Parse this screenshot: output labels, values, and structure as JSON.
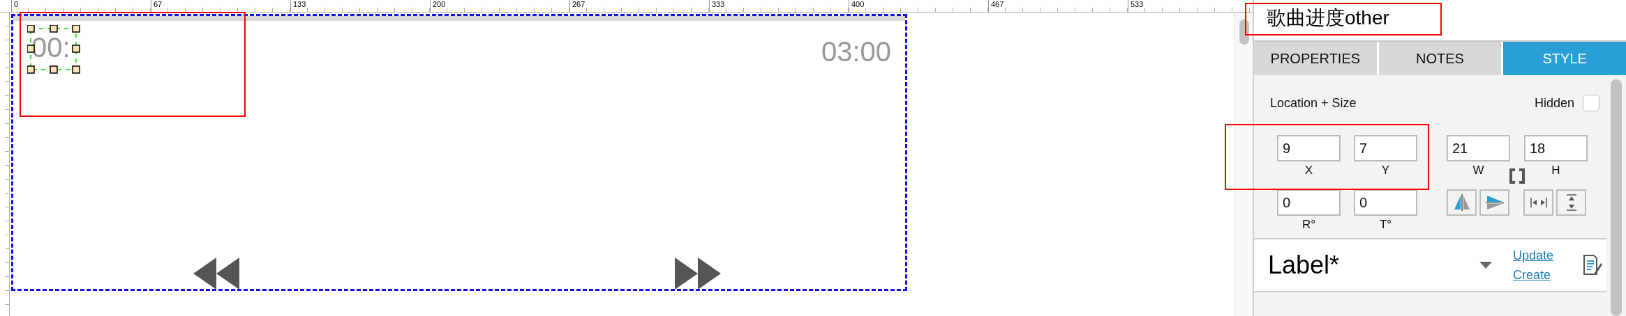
{
  "ruler": {
    "labels": [
      "0",
      "67",
      "133",
      "200",
      "267",
      "333",
      "400",
      "467",
      "533"
    ]
  },
  "canvas": {
    "start_time": "00:",
    "end_time": "03:00",
    "controls": [
      {
        "kind": "rewind"
      },
      {
        "kind": "fast_forward"
      }
    ]
  },
  "panel": {
    "title": "歌曲进度other",
    "tabs": [
      {
        "label": "PROPERTIES",
        "selected": false
      },
      {
        "label": "NOTES",
        "selected": false
      },
      {
        "label": "STYLE",
        "selected": true
      }
    ],
    "section": "Location + Size",
    "hidden": {
      "label": "Hidden",
      "checked": false
    },
    "fields": [
      {
        "value": "9",
        "label": "X"
      },
      {
        "value": "7",
        "label": "Y"
      },
      {
        "value": "21",
        "label": "W"
      },
      {
        "value": "18",
        "label": "H"
      },
      {
        "value": "0",
        "label": "R°"
      },
      {
        "value": "0",
        "label": "T°"
      }
    ],
    "buttons": [
      {
        "kind": "flip_horizontal"
      },
      {
        "kind": "flip_vertical"
      },
      {
        "kind": "distribute_horizontal"
      },
      {
        "kind": "distribute_vertical"
      }
    ],
    "style": {
      "name": "Label*",
      "links": [
        "Update",
        "Create"
      ]
    }
  }
}
